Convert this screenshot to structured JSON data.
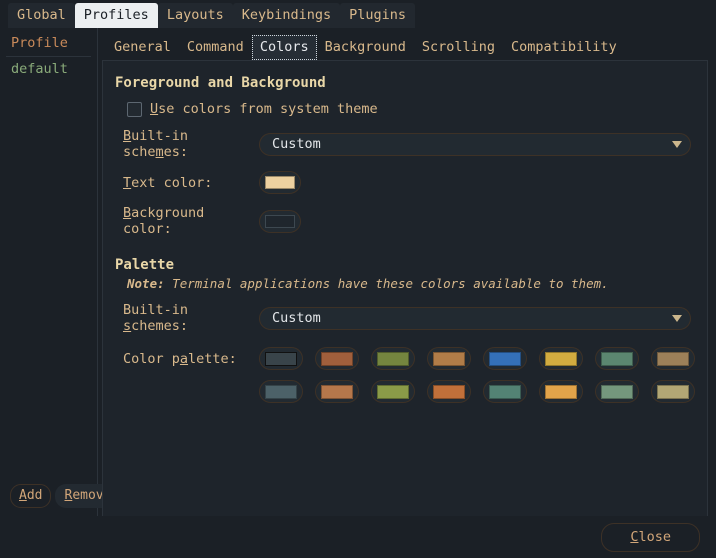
{
  "window": {
    "top_tabs": [
      {
        "label": "Global",
        "selected": false
      },
      {
        "label": "Profiles",
        "selected": true
      },
      {
        "label": "Layouts",
        "selected": false
      },
      {
        "label": "Keybindings",
        "selected": false
      },
      {
        "label": "Plugins",
        "selected": false
      }
    ]
  },
  "sidebar": {
    "header": "Profile",
    "items": [
      {
        "label": "default"
      }
    ],
    "add_label": "Add",
    "add_mnemonic": "A",
    "remove_label": "Remove",
    "remove_mnemonic": "R"
  },
  "sub_tabs": [
    {
      "label": "General",
      "selected": false
    },
    {
      "label": "Command",
      "selected": false
    },
    {
      "label": "Colors",
      "selected": true
    },
    {
      "label": "Background",
      "selected": false
    },
    {
      "label": "Scrolling",
      "selected": false
    },
    {
      "label": "Compatibility",
      "selected": false
    }
  ],
  "foreground_section": {
    "title": "Foreground and Background",
    "use_system_theme": {
      "label": "Use colors from system theme",
      "mnemonic": "U",
      "checked": false
    },
    "builtin_schemes": {
      "label_before": "Built-in sche",
      "mnemonic": "m",
      "label_after": "es:",
      "value": "Custom",
      "options": [
        "Custom"
      ]
    },
    "text_color": {
      "label_before": "",
      "mnemonic": "T",
      "label_after": "ext color:",
      "value": "#edd1a0"
    },
    "background_color": {
      "label_before": "",
      "mnemonic": "B",
      "label_after": "ackground color:",
      "value": "#1f262d"
    }
  },
  "palette_section": {
    "title": "Palette",
    "note_prefix": "Note:",
    "note_text": " Terminal applications have these colors available to them.",
    "builtin_schemes": {
      "label_before": "Built-in ",
      "mnemonic": "s",
      "label_after": "chemes:",
      "value": "Custom",
      "options": [
        "Custom"
      ]
    },
    "color_palette_label": {
      "label_before": "Color p",
      "mnemonic": "a",
      "label_after": "lette:"
    },
    "rows": [
      [
        "#39444a",
        "#a05f3c",
        "#74853f",
        "#b07c48",
        "#3470b8",
        "#d2ac40",
        "#5b8670",
        "#9c8059"
      ],
      [
        "#4c6168",
        "#b5774b",
        "#8a9b48",
        "#c1703a",
        "#538274",
        "#e2a44a",
        "#74977d",
        "#b2a775"
      ]
    ]
  },
  "footer": {
    "close_label": "Close",
    "close_mnemonic": "C"
  },
  "theme": {
    "window_bg": "#1b2026",
    "panel_bg": "#1e242b",
    "accent_text": "#d9b98c",
    "selected_tab_bg": "#eceff1"
  }
}
